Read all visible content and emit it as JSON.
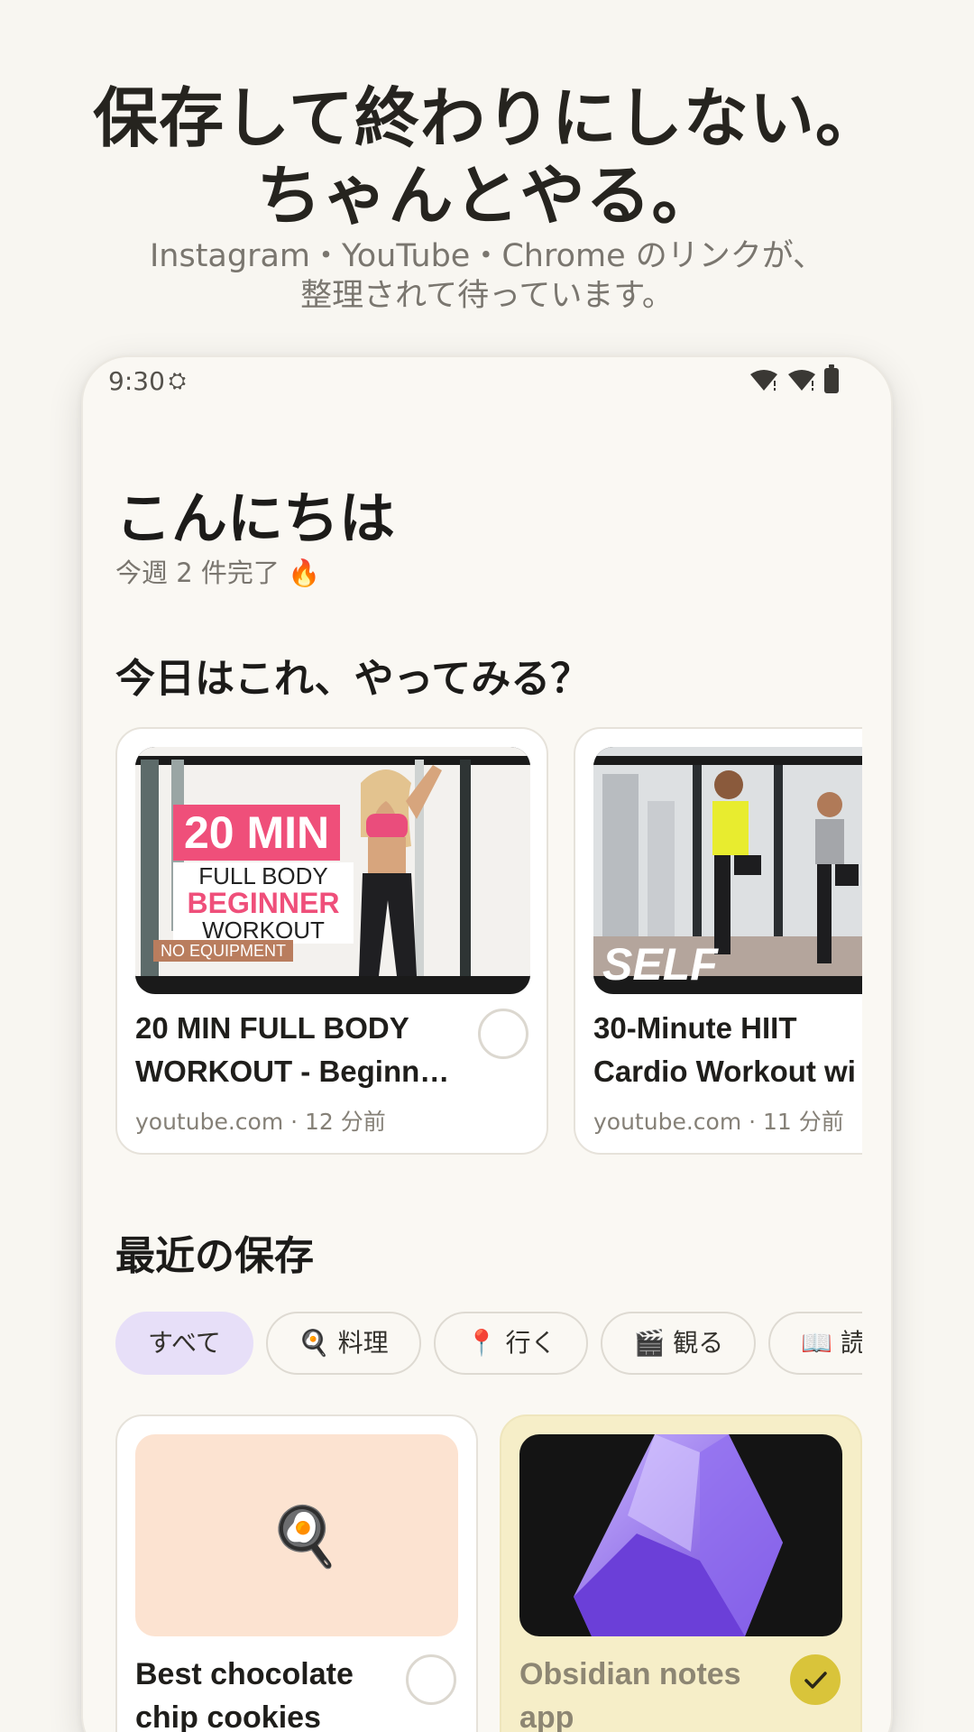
{
  "hero": {
    "title_line1": "保存して終わりにしない。",
    "title_line2": "ちゃんとやる。",
    "sub_line1": "Instagram・YouTube・Chrome のリンクが、",
    "sub_line2": "整理されて待っています。"
  },
  "status_bar": {
    "time": "9:30"
  },
  "home": {
    "greeting": "こんにちは",
    "week_stat": "今週 2 件完了 🔥",
    "today_title": "今日はこれ、やってみる？",
    "recent_title": "最近の保存"
  },
  "today_cards": [
    {
      "title_line1": "20 MIN FULL BODY",
      "title_line2": "WORKOUT - Beginn…",
      "meta": "youtube.com · 12 分前",
      "thumb_big": "20 MIN",
      "thumb_l1": "FULL BODY",
      "thumb_l2": "BEGINNER",
      "thumb_l3": "WORKOUT",
      "thumb_tag": "NO EQUIPMENT"
    },
    {
      "title_line1": "30-Minute HIIT",
      "title_line2": "Cardio Workout wi",
      "meta": "youtube.com · 11 分前",
      "thumb_logo": "SELF"
    }
  ],
  "chips": [
    "すべて",
    "🍳 料理",
    "📍 行く",
    "🎬 観る",
    "📖 読"
  ],
  "saved_cards": [
    {
      "title_line1": "Best chocolate",
      "title_line2": "chip cookies",
      "icon": "🍳",
      "done": false
    },
    {
      "title_line1": "Obsidian notes",
      "title_line2": "app",
      "done": true
    }
  ],
  "colors": {
    "background": "#f8f6f1",
    "chip_active": "#e7dff8",
    "done_card": "#f6eec8",
    "done_check": "#d9c43a"
  }
}
